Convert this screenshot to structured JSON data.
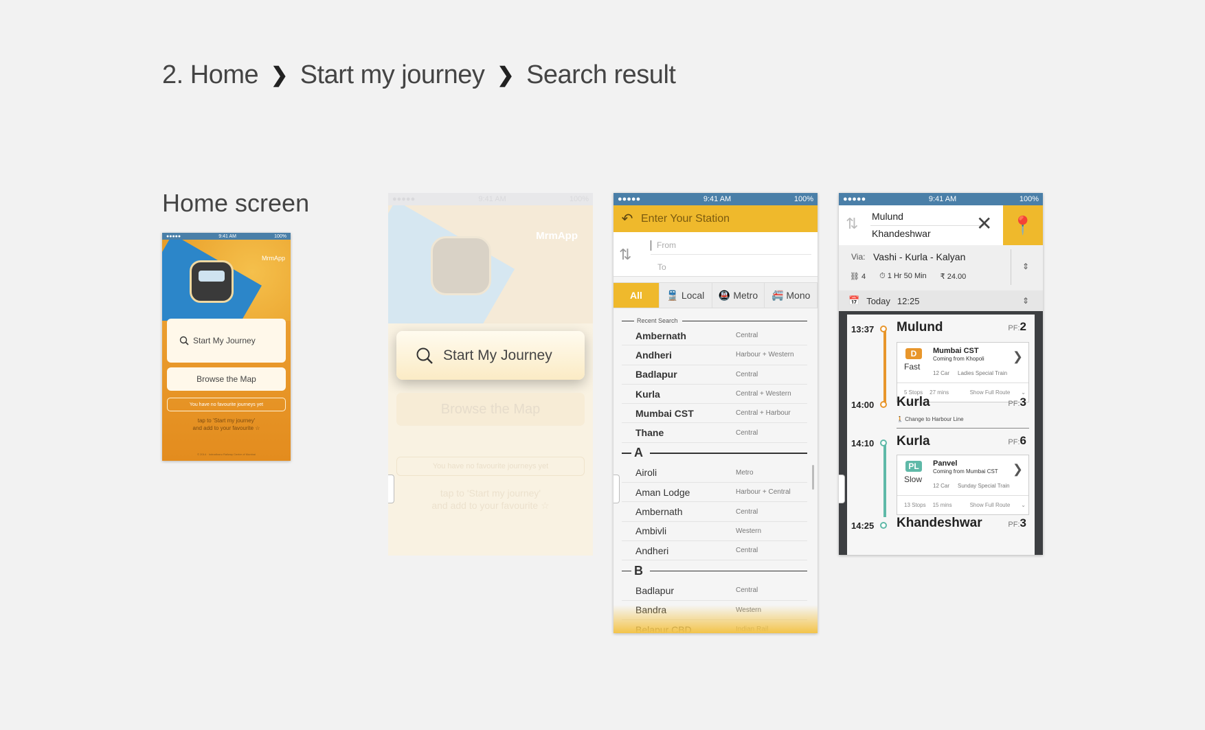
{
  "breadcrumb": {
    "step1": "2. Home",
    "step2": "Start my journey",
    "step3": "Search result",
    "sep": "❯"
  },
  "section_title": "Home screen",
  "status": {
    "dots": "●●●●● ",
    "time": "9:41 AM",
    "battery": "100%"
  },
  "home_small": {
    "brand": "MrmApp",
    "start": "Start My Journey",
    "browse": "Browse the Map",
    "fav_empty": "You have no favourite journeys yet",
    "tap_line1": "tap to 'Start my journey'",
    "tap_line2": "and add to your favourite ☆",
    "footer": "© 2014 · Indradhanu Railway Centre of Mumbai"
  },
  "home_faded": {
    "brand": "MrmApp",
    "start": "Start My Journey",
    "browse": "Browse the Map",
    "fav_empty": "You have no favourite journeys yet",
    "tap_line1": "tap to 'Start my journey'",
    "tap_line2": "and add to your favourite ☆"
  },
  "station_screen": {
    "header": "Enter Your Station",
    "from_placeholder": "From",
    "to_placeholder": "To",
    "filters": [
      "All",
      "Local",
      "Metro",
      "Mono"
    ],
    "recent_label": "Recent Search",
    "recent": [
      {
        "name": "Ambernath",
        "line": "Central"
      },
      {
        "name": "Andheri",
        "line": "Harbour + Western"
      },
      {
        "name": "Badlapur",
        "line": "Central"
      },
      {
        "name": "Kurla",
        "line": "Central + Western"
      },
      {
        "name": "Mumbai CST",
        "line": "Central + Harbour"
      },
      {
        "name": "Thane",
        "line": "Central"
      }
    ],
    "section_a": "A",
    "a_list": [
      {
        "name": "Airoli",
        "line": "Metro"
      },
      {
        "name": "Aman Lodge",
        "line": "Harbour + Central"
      },
      {
        "name": "Ambernath",
        "line": "Central"
      },
      {
        "name": "Ambivli",
        "line": "Western"
      },
      {
        "name": "Andheri",
        "line": "Central"
      }
    ],
    "section_b": "B",
    "b_list": [
      {
        "name": "Badlapur",
        "line": "Central"
      },
      {
        "name": "Bandra",
        "line": "Western"
      },
      {
        "name": "Belapur CBD",
        "line": "Indian Rail"
      }
    ]
  },
  "result_screen": {
    "from": "Mulund",
    "to": "Khandeshwar",
    "via_label": "Via:",
    "via": "Vashi - Kurla - Kalyan",
    "changes": "4",
    "duration": "1 Hr 50 Min",
    "fare": "₹ 24.00",
    "day": "Today",
    "time": "12:25",
    "stops": [
      {
        "time": "13:37",
        "name": "Mulund",
        "pf_label": "PF:",
        "pf": "2"
      },
      {
        "time": "14:00",
        "name": "Kurla",
        "pf_label": "PF:",
        "pf": "3"
      },
      {
        "time": "14:10",
        "name": "Kurla",
        "pf_label": "PF:",
        "pf": "6"
      },
      {
        "time": "14:25",
        "name": "Khandeshwar",
        "pf_label": "PF:",
        "pf": "3"
      }
    ],
    "train1": {
      "badge": "D",
      "speed": "Fast",
      "dest": "Mumbai CST",
      "from": "Coming from Khopoli",
      "cars": "12 Car",
      "type": "Ladies Special Train",
      "stops": "5 Stops",
      "mins": "27 mins",
      "show": "Show Full Route"
    },
    "change_text": "Change to Harbour Line",
    "train2": {
      "badge": "PL",
      "speed": "Slow",
      "dest": "Panvel",
      "from": "Coming from Mumbai CST",
      "cars": "12 Car",
      "type": "Sunday Special Train",
      "stops": "13 Stops",
      "mins": "15 mins",
      "show": "Show Full Route"
    },
    "colors": {
      "line1": "#e8962b",
      "line2": "#5fb9a8"
    }
  }
}
